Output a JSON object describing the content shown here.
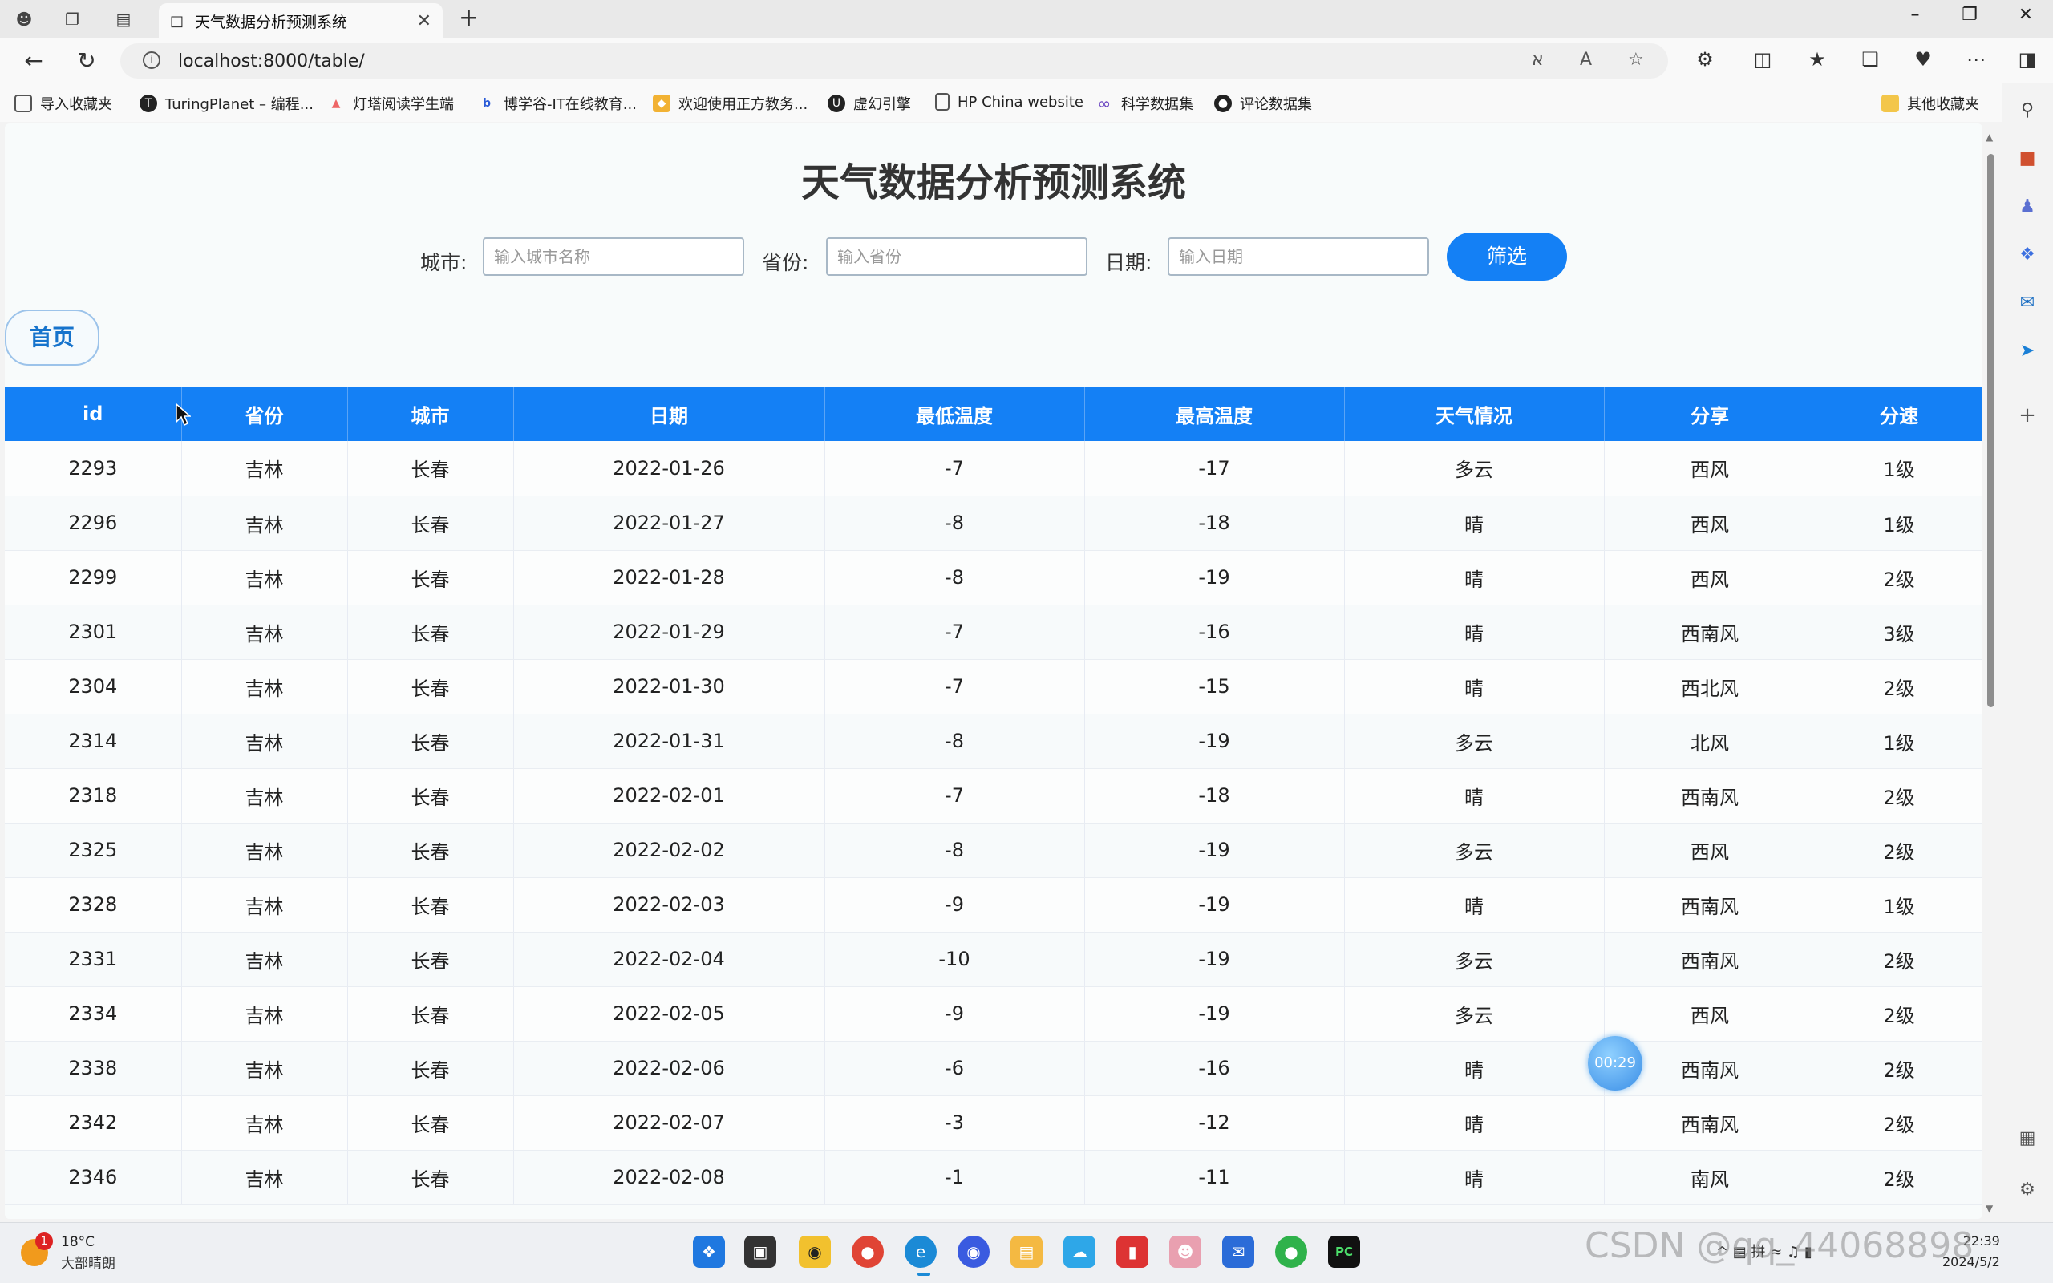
{
  "browser": {
    "tab_title": "天气数据分析预测系统",
    "url": "localhost:8000/table/",
    "bookmarks": [
      {
        "label": "导入收藏夹",
        "icon": "import-icon"
      },
      {
        "label": "TuringPlanet – 编程...",
        "icon": "turing-icon"
      },
      {
        "label": "灯塔阅读学生端",
        "icon": "lighthouse-icon"
      },
      {
        "label": "博学谷-IT在线教育...",
        "icon": "boxuegu-icon"
      },
      {
        "label": "欢迎使用正方教务...",
        "icon": "zhengfang-icon"
      },
      {
        "label": "虚幻引擎",
        "icon": "unreal-icon"
      },
      {
        "label": "HP China website",
        "icon": "page-icon"
      },
      {
        "label": "科学数据集",
        "icon": "infinity-icon"
      },
      {
        "label": "评论数据集",
        "icon": "github-icon"
      }
    ],
    "other_bookmarks": "其他收藏夹"
  },
  "page": {
    "title": "天气数据分析预测系统",
    "filters": {
      "city_label": "城市:",
      "city_placeholder": "输入城市名称",
      "province_label": "省份:",
      "province_placeholder": "输入省份",
      "date_label": "日期:",
      "date_placeholder": "输入日期",
      "submit_label": "筛选"
    },
    "home_label": "首页"
  },
  "table": {
    "columns": [
      "id",
      "省份",
      "城市",
      "日期",
      "最低温度",
      "最高温度",
      "天气情况",
      "分享",
      "分速"
    ],
    "rows": [
      [
        "2293",
        "吉林",
        "长春",
        "2022-01-26",
        "-7",
        "-17",
        "多云",
        "西风",
        "1级"
      ],
      [
        "2296",
        "吉林",
        "长春",
        "2022-01-27",
        "-8",
        "-18",
        "晴",
        "西风",
        "1级"
      ],
      [
        "2299",
        "吉林",
        "长春",
        "2022-01-28",
        "-8",
        "-19",
        "晴",
        "西风",
        "2级"
      ],
      [
        "2301",
        "吉林",
        "长春",
        "2022-01-29",
        "-7",
        "-16",
        "晴",
        "西南风",
        "3级"
      ],
      [
        "2304",
        "吉林",
        "长春",
        "2022-01-30",
        "-7",
        "-15",
        "晴",
        "西北风",
        "2级"
      ],
      [
        "2314",
        "吉林",
        "长春",
        "2022-01-31",
        "-8",
        "-19",
        "多云",
        "北风",
        "1级"
      ],
      [
        "2318",
        "吉林",
        "长春",
        "2022-02-01",
        "-7",
        "-18",
        "晴",
        "西南风",
        "2级"
      ],
      [
        "2325",
        "吉林",
        "长春",
        "2022-02-02",
        "-8",
        "-19",
        "多云",
        "西风",
        "2级"
      ],
      [
        "2328",
        "吉林",
        "长春",
        "2022-02-03",
        "-9",
        "-19",
        "晴",
        "西南风",
        "1级"
      ],
      [
        "2331",
        "吉林",
        "长春",
        "2022-02-04",
        "-10",
        "-19",
        "多云",
        "西南风",
        "2级"
      ],
      [
        "2334",
        "吉林",
        "长春",
        "2022-02-05",
        "-9",
        "-19",
        "多云",
        "西风",
        "2级"
      ],
      [
        "2338",
        "吉林",
        "长春",
        "2022-02-06",
        "-6",
        "-16",
        "晴",
        "西南风",
        "2级"
      ],
      [
        "2342",
        "吉林",
        "长春",
        "2022-02-07",
        "-3",
        "-12",
        "晴",
        "西南风",
        "2级"
      ],
      [
        "2346",
        "吉林",
        "长春",
        "2022-02-08",
        "-1",
        "-11",
        "晴",
        "南风",
        "2级"
      ]
    ]
  },
  "overlay": {
    "timer": "00:29"
  },
  "taskbar": {
    "weather_temp": "18°C",
    "weather_cond": "大部晴朗",
    "weather_badge": "1",
    "time": "22:39",
    "date": "2024/5/2"
  },
  "watermark": "CSDN @qq_44068898"
}
